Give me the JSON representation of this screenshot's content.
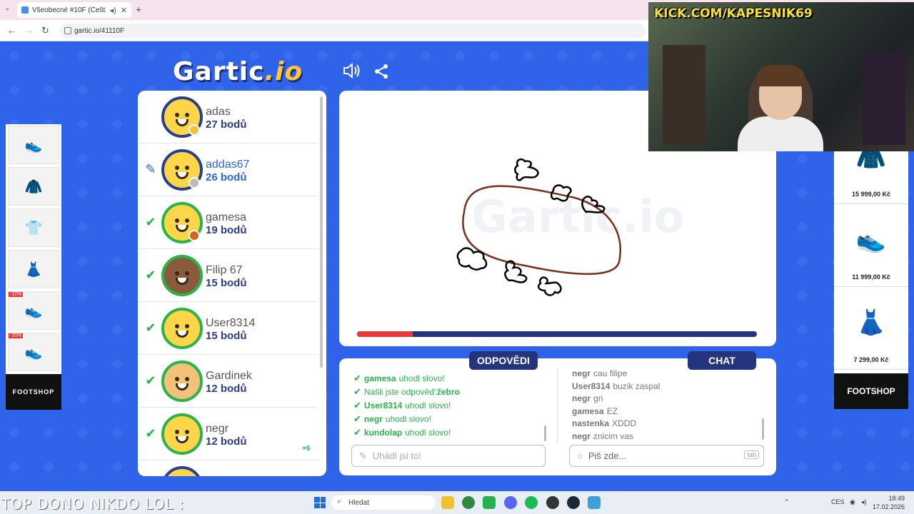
{
  "browser": {
    "tab_title": "Všeobecné #10F (Čeština)",
    "url": "gartic.io/41110F"
  },
  "game": {
    "logo_main": "Gartic",
    "logo_suffix": ".io",
    "players": [
      {
        "name": "adas",
        "score": "27 bodů",
        "status": "",
        "badge_color": "#f5c03a",
        "avatar": "smile",
        "delta": ""
      },
      {
        "name": "addas67",
        "score": "26 bodů",
        "status": "pen",
        "badge_color": "#bbbbbb",
        "avatar": "smile",
        "delta": ""
      },
      {
        "name": "gamesa",
        "score": "19 bodů",
        "status": "check",
        "badge_color": "#d0661e",
        "avatar": "smile",
        "delta": ""
      },
      {
        "name": "Filip 67",
        "score": "15 bodů",
        "status": "check",
        "badge_color": "",
        "avatar": "dark",
        "delta": ""
      },
      {
        "name": "User8314",
        "score": "15 bodů",
        "status": "check",
        "badge_color": "",
        "avatar": "smile",
        "delta": ""
      },
      {
        "name": "Gardinek",
        "score": "12 bodů",
        "status": "check",
        "badge_color": "",
        "avatar": "glasses",
        "delta": ""
      },
      {
        "name": "negr",
        "score": "12 bodů",
        "status": "check",
        "badge_color": "",
        "avatar": "smile",
        "delta": "+6"
      }
    ],
    "timer_fraction": 0.14,
    "answers_label": "ODPOVĚDI",
    "chat_label": "CHAT",
    "answers": [
      {
        "who": "gamesa",
        "text": "uhodl slovo!"
      },
      {
        "who": "",
        "text": "Našli jste odpověď: ",
        "word": "žebro"
      },
      {
        "who": "User8314",
        "text": "uhodl slovo!"
      },
      {
        "who": "negr",
        "text": "uhodl slovo!"
      },
      {
        "who": "kundolap",
        "text": "uhodl slovo!"
      }
    ],
    "chat": [
      {
        "who": "negr",
        "text": "cau filipe"
      },
      {
        "who": "User8314",
        "text": "buzik zaspal"
      },
      {
        "who": "negr",
        "text": "gn"
      },
      {
        "who": "gamesa",
        "text": "EZ"
      },
      {
        "who": "nastenka",
        "text": "XDDD"
      },
      {
        "who": "negr",
        "text": "znicim vas"
      }
    ],
    "answer_placeholder": "Uhádl jsi to!",
    "chat_placeholder": "Piš zde...",
    "tab_key": "tab"
  },
  "ads": {
    "left_brand": "FOOTSHOP",
    "left_tags": [
      "-10%",
      "-20%"
    ],
    "right_brand": "FOOTSHOP",
    "right_prices": [
      "15 999,00 Kč",
      "11 999,00 Kč",
      "7 299,00 Kč"
    ]
  },
  "stream": {
    "banner": "KICK.COM/KAPESNIK69",
    "overlay_text": "TOP DONO NIKDO LOL :"
  },
  "taskbar": {
    "search": "Hledat",
    "lang": "CES",
    "time": "18:49",
    "date": "17.02.2026"
  }
}
